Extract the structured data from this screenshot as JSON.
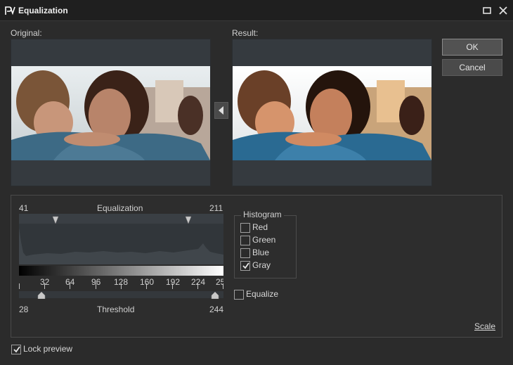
{
  "window": {
    "title": "Equalization",
    "icons": {
      "app": "pv-logo-icon",
      "maximize": "maximize-icon",
      "close": "close-icon"
    }
  },
  "preview": {
    "original_label": "Original:",
    "result_label": "Result:",
    "arrow_icon": "triangle-left-icon"
  },
  "buttons": {
    "ok": "OK",
    "cancel": "Cancel"
  },
  "equalization": {
    "title": "Equalization",
    "low": "41",
    "high": "211",
    "tick_labels": [
      "32",
      "64",
      "96",
      "128",
      "160",
      "192",
      "224",
      "25"
    ],
    "threshold_label": "Threshold",
    "threshold_low": "28",
    "threshold_high": "244"
  },
  "histogram_group": {
    "title": "Histogram",
    "channels": [
      {
        "label": "Red",
        "checked": false
      },
      {
        "label": "Green",
        "checked": false
      },
      {
        "label": "Blue",
        "checked": false
      },
      {
        "label": "Gray",
        "checked": true
      }
    ]
  },
  "equalize": {
    "label": "Equalize",
    "checked": false
  },
  "scale_link": "Scale",
  "lock_preview": {
    "label": "Lock preview",
    "checked": true
  },
  "colors": {
    "background": "#2b2b2b",
    "titlebar": "#1f1f1f",
    "preview_bg": "#353a3f",
    "histogram_bg": "#31363a"
  }
}
